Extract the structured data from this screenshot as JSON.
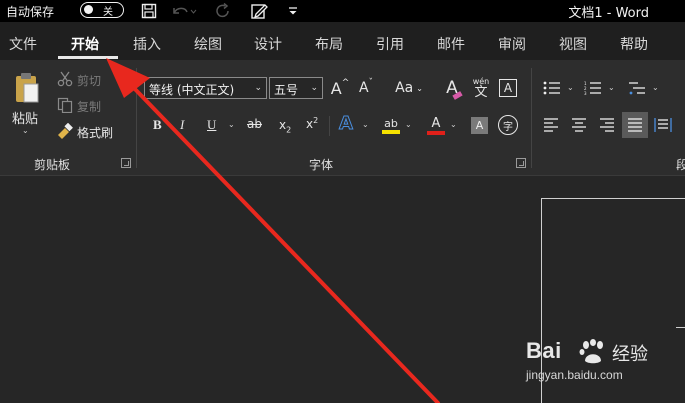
{
  "titlebar": {
    "autosave_label": "自动保存",
    "autosave_state": "关",
    "doc_title": "文档1  -  Word"
  },
  "tabs": [
    {
      "label": "文件"
    },
    {
      "label": "开始",
      "active": true
    },
    {
      "label": "插入"
    },
    {
      "label": "绘图"
    },
    {
      "label": "设计"
    },
    {
      "label": "布局"
    },
    {
      "label": "引用"
    },
    {
      "label": "邮件"
    },
    {
      "label": "审阅"
    },
    {
      "label": "视图"
    },
    {
      "label": "帮助"
    }
  ],
  "clipboard": {
    "paste_label": "粘贴",
    "cut_label": "剪切",
    "copy_label": "复制",
    "format_painter_label": "格式刷",
    "group_label": "剪贴板"
  },
  "font": {
    "font_name": "等线 (中文正文)",
    "font_size": "五号",
    "change_case_label": "Aa",
    "group_label": "字体",
    "bold": "B",
    "italic": "I",
    "underline": "U",
    "strike": "ab",
    "subscript": "x",
    "superscript": "x",
    "sub_mark": "2",
    "sup_mark": "2",
    "phonetic_top": "wén",
    "phonetic_bottom": "文",
    "border_char": "A",
    "effects": "A",
    "highlight": "ab",
    "font_color": "A",
    "shade_char": "A",
    "enclose_char": "字",
    "grow": "A",
    "shrink": "A",
    "clear": "A"
  },
  "paragraph": {
    "group_label_partial": "段"
  },
  "watermark": {
    "brand": "Bai",
    "brand_tail": "经验",
    "url": "jingyan.baidu.com"
  },
  "colors": {
    "accent_arrow": "#e8281e",
    "highlight_yellow": "#f5e100",
    "font_red": "#e0201a",
    "effects_blue": "#4a8fe0"
  }
}
